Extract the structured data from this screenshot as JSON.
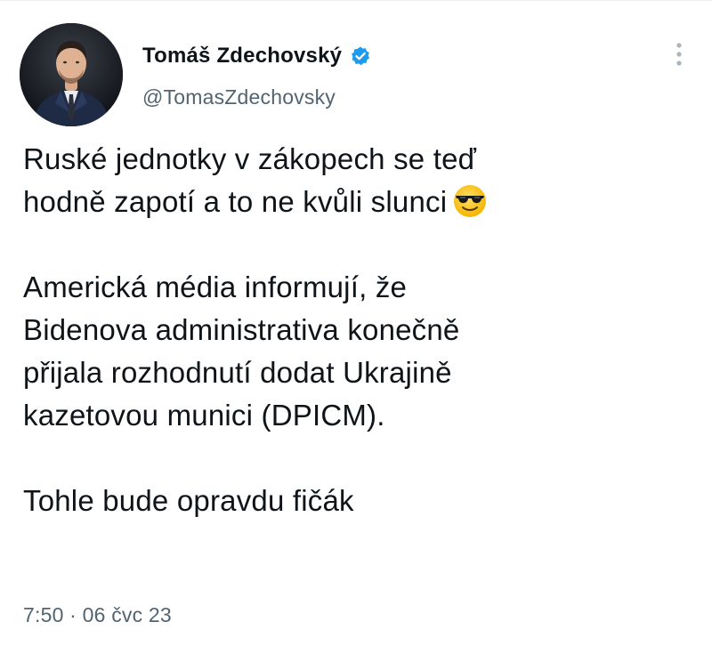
{
  "author": {
    "display_name": "Tomáš Zdechovský",
    "handle": "@TomasZdechovsky",
    "verified": true
  },
  "tweet": {
    "paragraphs": [
      [
        "Ruské jednotky v zákopech se teď",
        "hodně zapotí a to ne kvůli slunci"
      ],
      [
        "Americká média informují, že",
        "Bidenova administrativa konečně",
        "přijala rozhodnutí dodat Ukrajině",
        "kazetovou munici (DPICM)."
      ],
      [
        "Tohle bude opravdu fičák"
      ]
    ],
    "emoji": "smiling-face-with-sunglasses"
  },
  "meta": {
    "time": "7:50",
    "separator": " · ",
    "date": "06 čvc 23"
  },
  "icons": {
    "verified": "verified-badge-icon",
    "more": "more-vertical-icon"
  },
  "colors": {
    "text": "#0f1419",
    "secondary": "#536471",
    "verified_blue": "#1d9bf0",
    "background": "#ffffff"
  }
}
